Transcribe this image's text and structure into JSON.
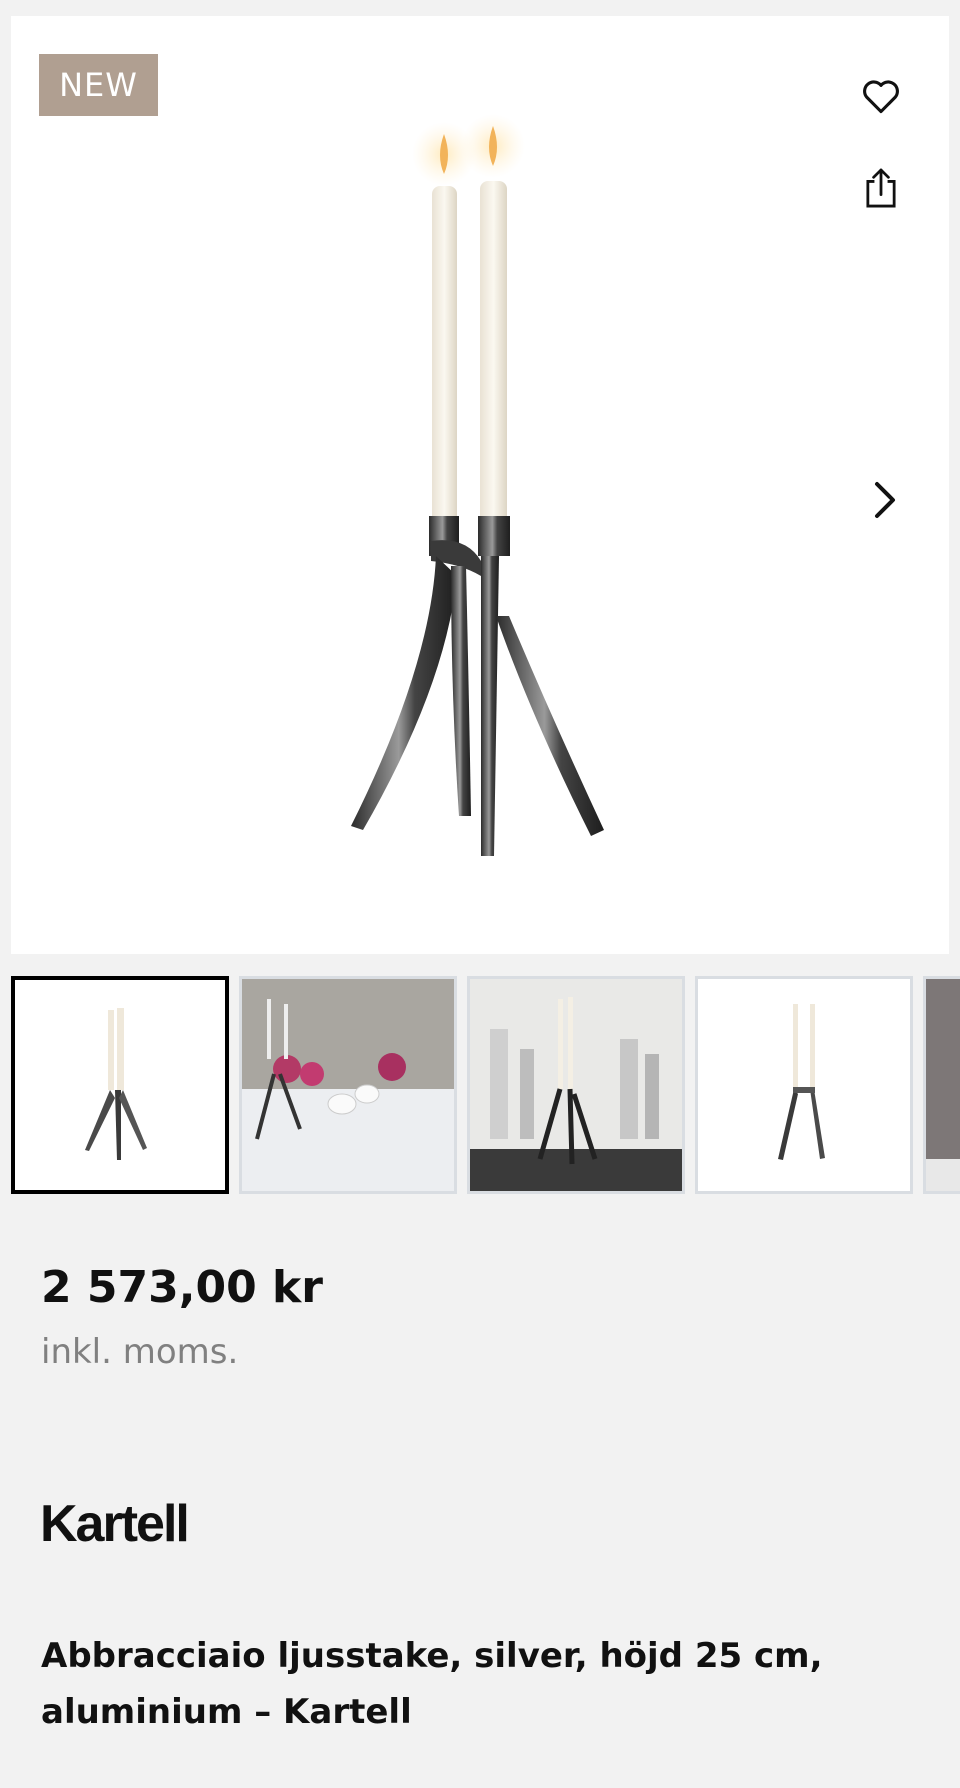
{
  "badge": {
    "label": "NEW",
    "color": "#b09f91"
  },
  "actions": {
    "favorite_icon": "heart-icon",
    "share_icon": "share-icon",
    "next_icon": "chevron-right-icon"
  },
  "gallery": {
    "thumbnails": [
      {
        "description": "candle holder on white",
        "selected": true
      },
      {
        "description": "table setting with candles and flowers",
        "selected": false
      },
      {
        "description": "candle holder with glassware",
        "selected": false
      },
      {
        "description": "candle holder front view",
        "selected": false
      }
    ]
  },
  "product": {
    "price": "2 573,00 kr",
    "vat_note": "inkl. moms.",
    "brand": "Kartell",
    "title": "Abbracciaio ljusstake, silver, höjd 25 cm, aluminium – Kartell"
  }
}
